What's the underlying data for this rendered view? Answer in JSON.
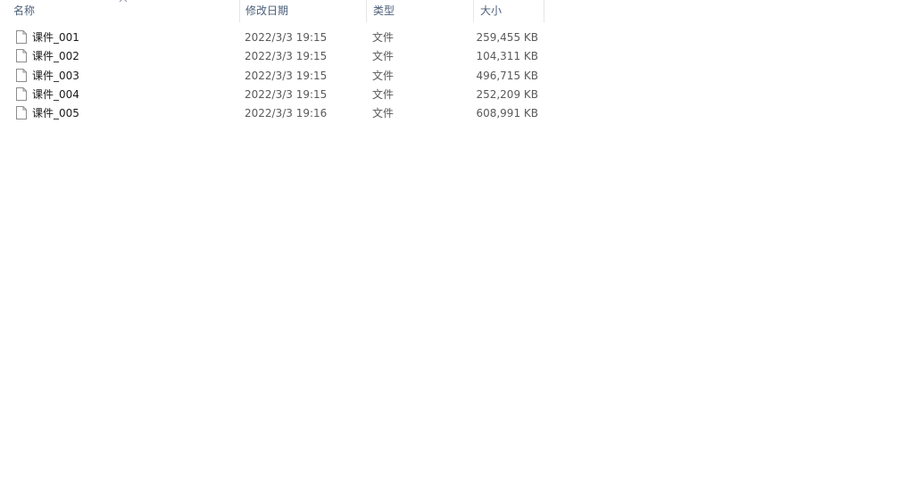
{
  "columns": {
    "name": "名称",
    "date": "修改日期",
    "type": "类型",
    "size": "大小"
  },
  "sort_indicator": "chevron-up-icon",
  "files": [
    {
      "name": "课件_001",
      "modified": "2022/3/3 19:15",
      "type": "文件",
      "size": "259,455 KB"
    },
    {
      "name": "课件_002",
      "modified": "2022/3/3 19:15",
      "type": "文件",
      "size": "104,311 KB"
    },
    {
      "name": "课件_003",
      "modified": "2022/3/3 19:15",
      "type": "文件",
      "size": "496,715 KB"
    },
    {
      "name": "课件_004",
      "modified": "2022/3/3 19:15",
      "type": "文件",
      "size": "252,209 KB"
    },
    {
      "name": "课件_005",
      "modified": "2022/3/3 19:16",
      "type": "文件",
      "size": "608,991 KB"
    }
  ],
  "colors": {
    "header_text": "#4c607a",
    "separator": "#e5e5e5",
    "icon_stroke": "#8c8c8c"
  }
}
